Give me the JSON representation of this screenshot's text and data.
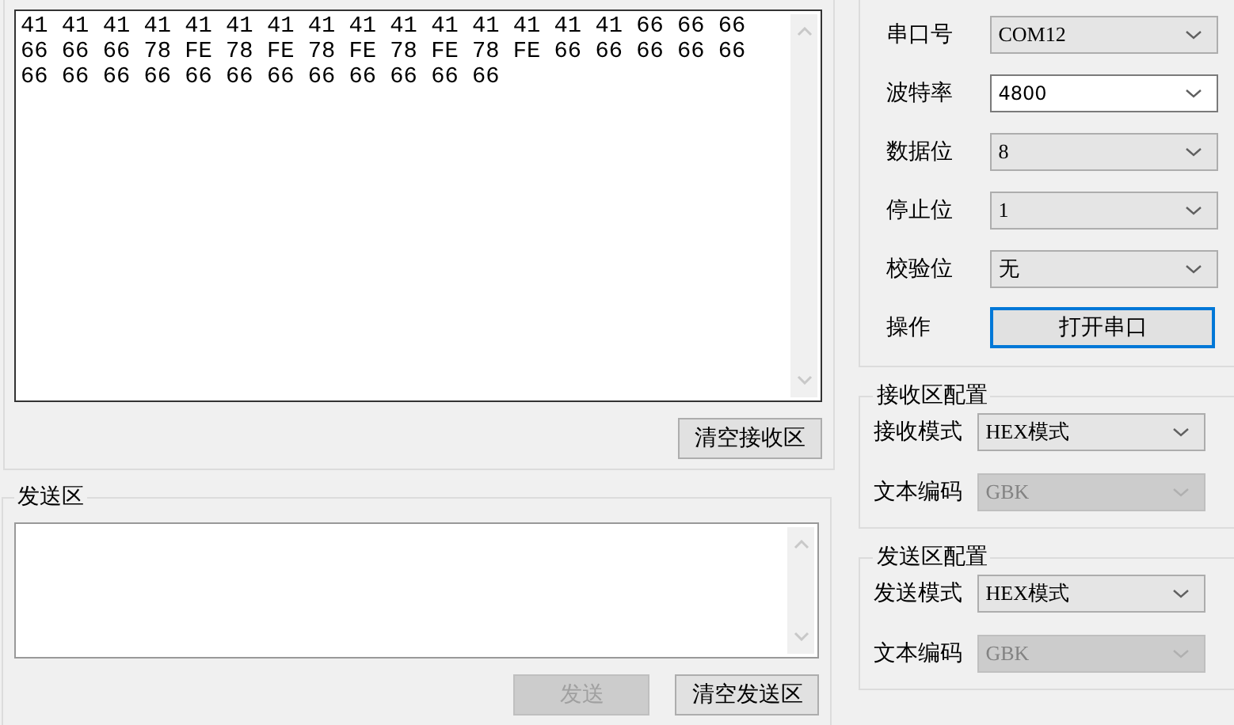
{
  "receive_area": {
    "lines": [
      "41 41 41 41 41 41 41 41 41 41 41 41 41 41 41 66 66 66",
      "66 66 66 78 FE 78 FE 78 FE 78 FE 78 FE 66 66 66 66 66",
      "66 66 66 66 66 66 66 66 66 66 66 66"
    ],
    "buttons": [
      {
        "label": "清空接收区",
        "disabled": false
      }
    ]
  },
  "send_area": {
    "title": "发送区",
    "buttons": [
      {
        "label": "发送",
        "disabled": true
      },
      {
        "label": "清空发送区",
        "disabled": false
      }
    ]
  },
  "serial_settings": {
    "fields": [
      {
        "label": "串口号",
        "value": "COM12",
        "editable": false,
        "disabled": false
      },
      {
        "label": "波特率",
        "value": "4800",
        "editable": true,
        "disabled": false
      },
      {
        "label": "数据位",
        "value": "8",
        "editable": false,
        "disabled": false
      },
      {
        "label": "停止位",
        "value": "1",
        "editable": false,
        "disabled": false
      },
      {
        "label": "校验位",
        "value": "无",
        "editable": false,
        "disabled": false
      }
    ],
    "action_label": "操作",
    "action_button": {
      "label": "打开串口",
      "focused": true
    }
  },
  "receive_config": {
    "title": "接收区配置",
    "fields": [
      {
        "label": "接收模式",
        "value": "HEX模式",
        "editable": false,
        "disabled": false
      },
      {
        "label": "文本编码",
        "value": "GBK",
        "editable": false,
        "disabled": true
      }
    ]
  },
  "send_config": {
    "title": "发送区配置",
    "fields": [
      {
        "label": "发送模式",
        "value": "HEX模式",
        "editable": false,
        "disabled": false
      },
      {
        "label": "文本编码",
        "value": "GBK",
        "editable": false,
        "disabled": true
      }
    ]
  }
}
